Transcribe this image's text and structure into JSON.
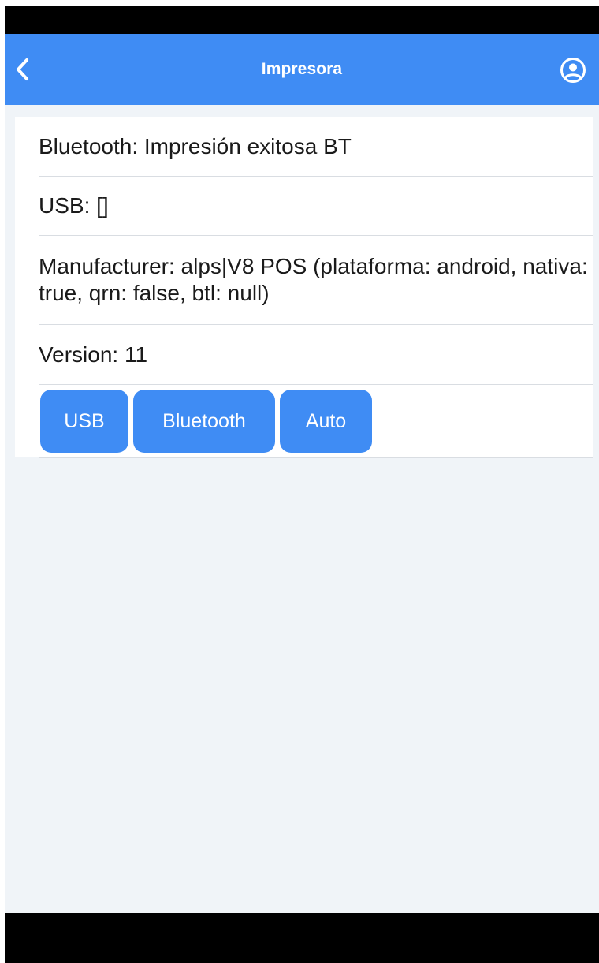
{
  "header": {
    "title": "Impresora",
    "back_icon": "chevron-left-icon",
    "account_icon": "user-circle-icon",
    "background_color": "#3f8cf4"
  },
  "info": {
    "bluetooth": "Bluetooth: Impresión exitosa BT",
    "usb": "USB: []",
    "manufacturer": "Manufacturer: alps|V8 POS (plataforma: android, nativa: true, qrn: false, btl: null)",
    "version": "Version: 11"
  },
  "actions": {
    "usb_label": "USB",
    "bluetooth_label": "Bluetooth",
    "auto_label": "Auto",
    "button_color": "#3f8cf4"
  }
}
